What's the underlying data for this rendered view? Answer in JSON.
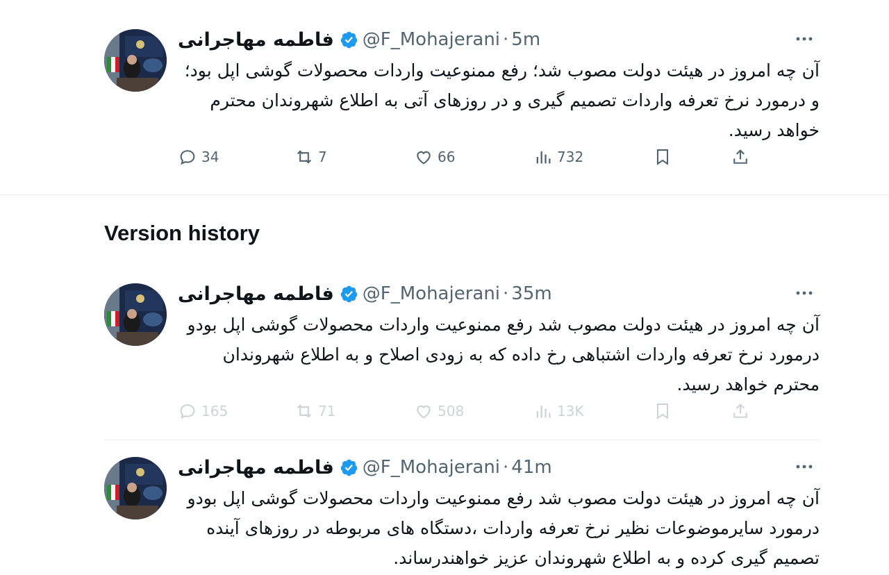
{
  "section_title": "Version history",
  "colors": {
    "verified": "#1d9bf0",
    "secondary_text": "#536471",
    "text": "#0f1419"
  },
  "current_tweet": {
    "name": "فاطمه مهاجرانی",
    "handle": "@F_Mohajerani",
    "time": "5m",
    "text": "آن چه امروز در هیئت دولت مصوب شد؛ رفع ممنوعیت واردات محصولات گوشی اپل بود؛و درمورد نرخ تعرفه واردات تصمیم گیری و در روزهای آتی به اطلاع شهروندان محترم خواهد رسید.",
    "replies": "34",
    "retweets": "7",
    "likes": "66",
    "views": "732"
  },
  "versions": [
    {
      "name": "فاطمه مهاجرانی",
      "handle": "@F_Mohajerani",
      "time": "35m",
      "text": "آن چه امروز در هیئت دولت مصوب شد رفع ممنوعیت واردات محصولات گوشی اپل بودو درمورد نرخ تعرفه واردات اشتباهی رخ داده که به زودی اصلاح و به اطلاع شهروندان محترم خواهد رسید.",
      "replies": "165",
      "retweets": "71",
      "likes": "508",
      "views": "13K"
    },
    {
      "name": "فاطمه مهاجرانی",
      "handle": "@F_Mohajerani",
      "time": "41m",
      "text": "آن چه امروز در هیئت دولت مصوب شد رفع ممنوعیت واردات محصولات گوشی اپل بودو درمورد سایرموضوعات نظیر نرخ تعرفه واردات ،دستگاه های مربوطه در روزهای آینده تصمیم گیری کرده و به اطلاع شهروندان عزیز خواهندرساند."
    }
  ]
}
